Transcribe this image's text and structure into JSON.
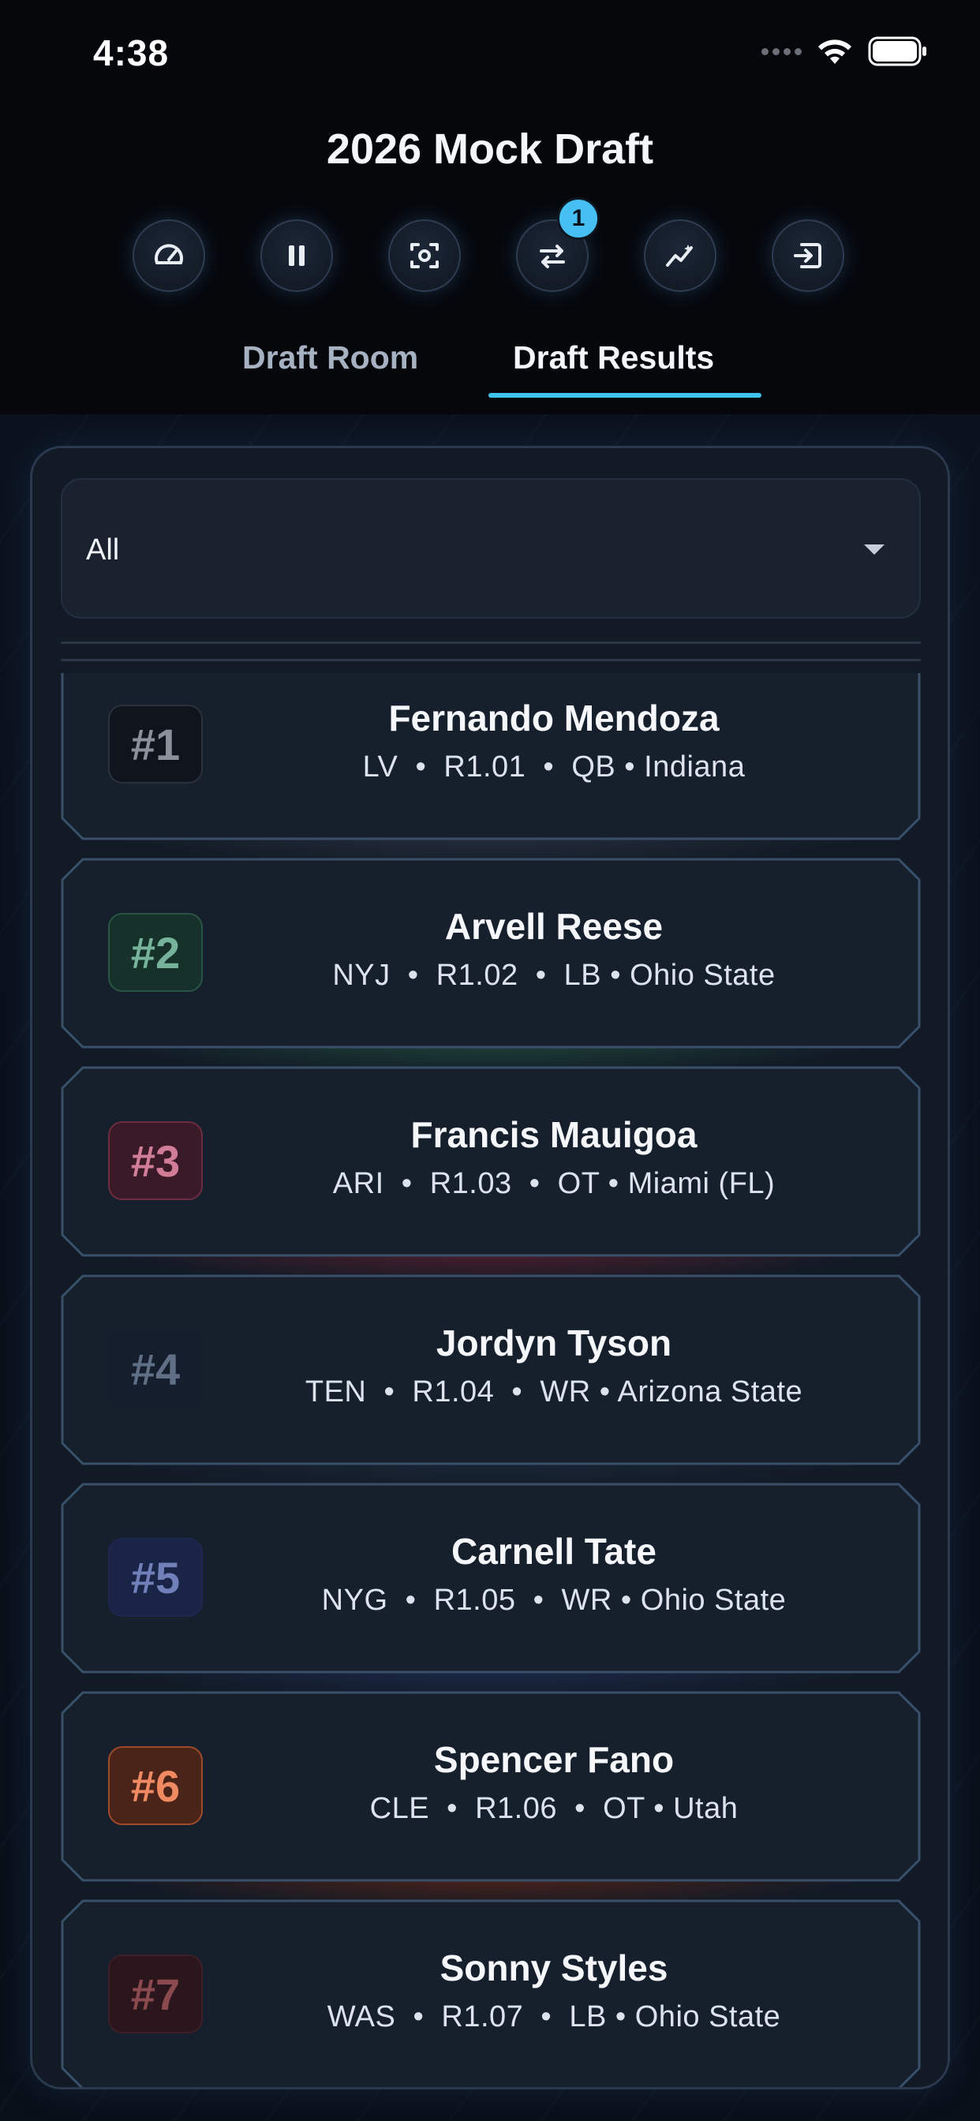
{
  "status_bar": {
    "time": "4:38"
  },
  "header": {
    "title": "2026 Mock Draft"
  },
  "toolbar": {
    "buttons": [
      {
        "name": "speedometer-icon"
      },
      {
        "name": "pause-icon"
      },
      {
        "name": "screenshot-icon"
      },
      {
        "name": "swap-icon",
        "badge": "1"
      },
      {
        "name": "trend-icon"
      },
      {
        "name": "exit-icon"
      }
    ]
  },
  "tabs": [
    {
      "label": "Draft Room",
      "active": false
    },
    {
      "label": "Draft Results",
      "active": true
    }
  ],
  "filter": {
    "value": "All"
  },
  "picks": [
    {
      "number": "#1",
      "name": "Fernando Mendoza",
      "team": "LV",
      "round": "R1.01",
      "position": "QB",
      "school": "Indiana",
      "num_color": "#8b919a",
      "num_bg": "#10151d",
      "num_border": "#2b323c",
      "accent": "#2a3340"
    },
    {
      "number": "#2",
      "name": "Arvell Reese",
      "team": "NYJ",
      "round": "R1.02",
      "position": "LB",
      "school": "Ohio State",
      "num_color": "#77b39a",
      "num_bg": "#16302a",
      "num_border": "#2a5544",
      "accent": "#20493c"
    },
    {
      "number": "#3",
      "name": "Francis Mauigoa",
      "team": "ARI",
      "round": "R1.03",
      "position": "OT",
      "school": "Miami (FL)",
      "num_color": "#d17d97",
      "num_bg": "#3a1a27",
      "num_border": "#6d2d41",
      "accent": "#5a1f2d"
    },
    {
      "number": "#4",
      "name": "Jordyn Tyson",
      "team": "TEN",
      "round": "R1.04",
      "position": "WR",
      "school": "Arizona State",
      "num_color": "#5f6f85",
      "num_bg": "#141e2c",
      "num_border": "#141e2c",
      "accent": "#1c2a3c"
    },
    {
      "number": "#5",
      "name": "Carnell Tate",
      "team": "NYG",
      "round": "R1.05",
      "position": "WR",
      "school": "Ohio State",
      "num_color": "#7180b8",
      "num_bg": "#192446",
      "num_border": "#1c2850",
      "accent": "#1e2c52"
    },
    {
      "number": "#6",
      "name": "Spencer Fano",
      "team": "CLE",
      "round": "R1.06",
      "position": "OT",
      "school": "Utah",
      "num_color": "#f08a62",
      "num_bg": "#4a2418",
      "num_border": "#a04a2c",
      "accent": "#5a2416"
    },
    {
      "number": "#7",
      "name": "Sonny Styles",
      "team": "WAS",
      "round": "R1.07",
      "position": "LB",
      "school": "Ohio State",
      "num_color": "#8a4a4e",
      "num_bg": "#2a161c",
      "num_border": "#3f1f26",
      "accent": "#3b1a20"
    }
  ]
}
